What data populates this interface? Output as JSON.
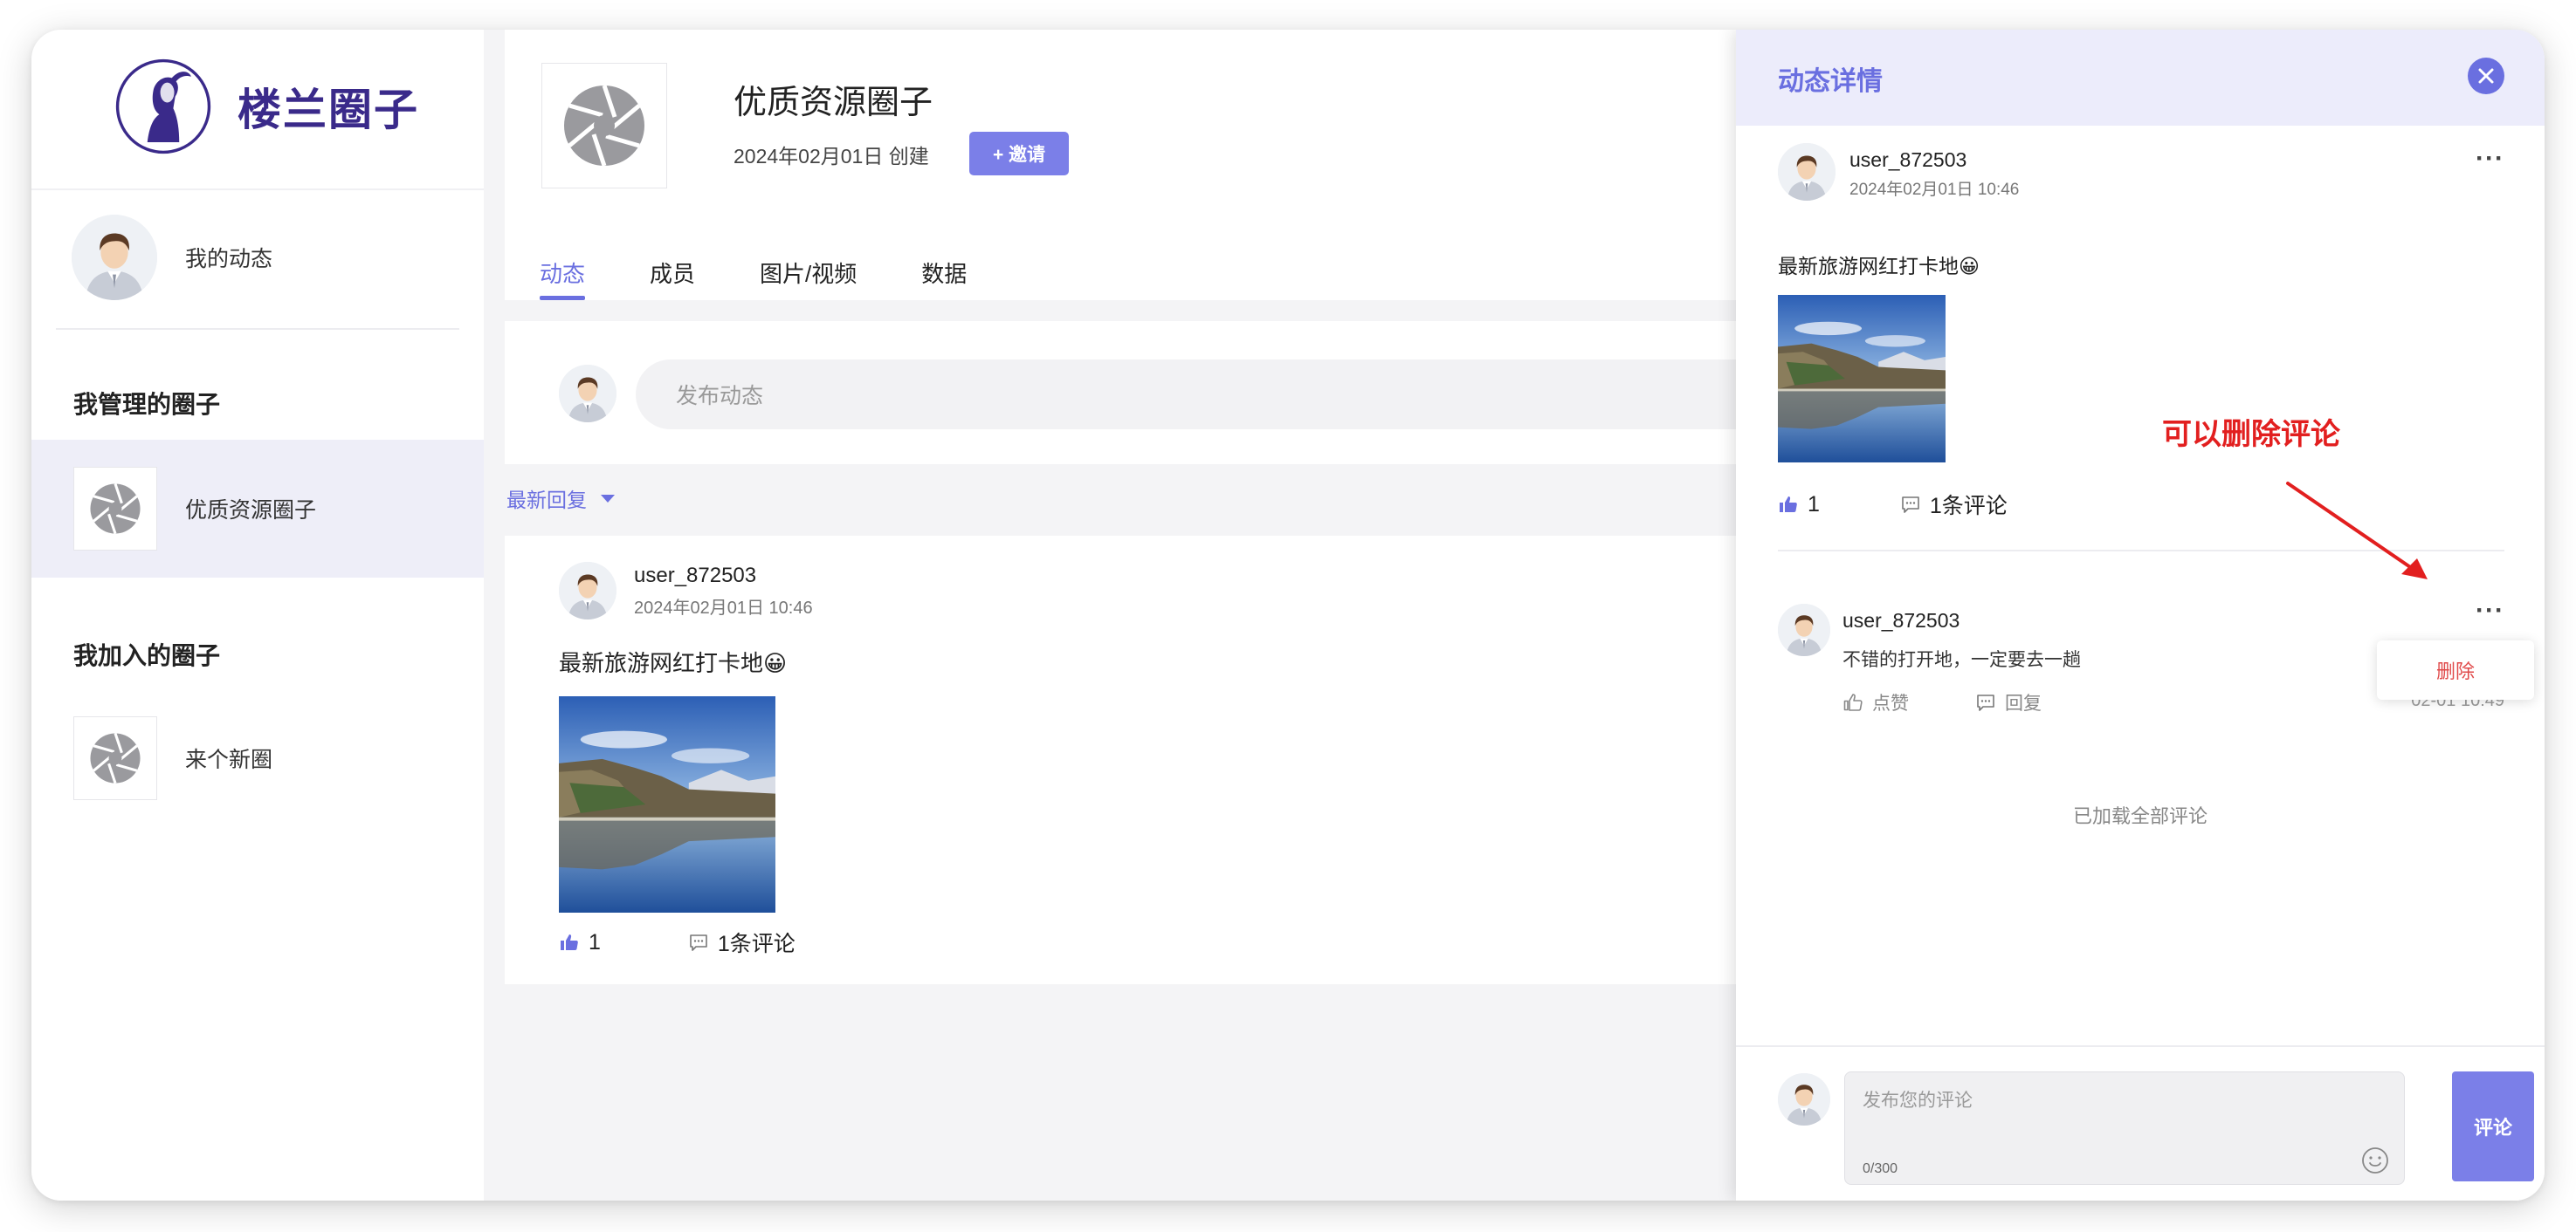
{
  "brand": {
    "name": "楼兰圈子",
    "accent": "#3a2a8a"
  },
  "sidebar": {
    "my_activity": "我的动态",
    "managed_title": "我管理的圈子",
    "managed_items": [
      {
        "label": "优质资源圈子"
      }
    ],
    "joined_title": "我加入的圈子",
    "joined_items": [
      {
        "label": "来个新圈"
      }
    ]
  },
  "group": {
    "title": "优质资源圈子",
    "created": "2024年02月01日 创建",
    "invite_label": "+ 邀请"
  },
  "tabs": [
    {
      "label": "动态",
      "active": true
    },
    {
      "label": "成员",
      "active": false
    },
    {
      "label": "图片/视频",
      "active": false
    },
    {
      "label": "数据",
      "active": false
    }
  ],
  "composer": {
    "placeholder": "发布动态"
  },
  "sort": {
    "label": "最新回复"
  },
  "feed": [
    {
      "user": "user_872503",
      "time": "2024年02月01日 10:46",
      "text": "最新旅游网红打卡地😀",
      "likes": "1",
      "comments": "1条评论"
    }
  ],
  "detail": {
    "title": "动态详情",
    "post": {
      "user": "user_872503",
      "time": "2024年02月01日 10:46",
      "text": "最新旅游网红打卡地😀",
      "likes": "1",
      "comments": "1条评论"
    },
    "comment": {
      "user": "user_872503",
      "text": "不错的打开地，一定要去一趟",
      "like_label": "点赞",
      "reply_label": "回复",
      "time": "02-01 10:49"
    },
    "menu": {
      "delete_label": "删除"
    },
    "loaded_all": "已加载全部评论",
    "composer": {
      "placeholder": "发布您的评论",
      "count": "0/300",
      "submit_label": "评论"
    }
  },
  "annotation": {
    "text": "可以删除评论",
    "color": "#e21f1f"
  },
  "colors": {
    "accent": "#6a6fe0",
    "button": "#7b7fe8",
    "panel_header": "#ececfb",
    "danger": "#e04a4a"
  },
  "icons": [
    "brand-logo-icon",
    "shutter-icon",
    "thumb-up-icon",
    "comment-icon",
    "close-icon",
    "more-icon",
    "emoji-icon",
    "caret-down-icon"
  ]
}
